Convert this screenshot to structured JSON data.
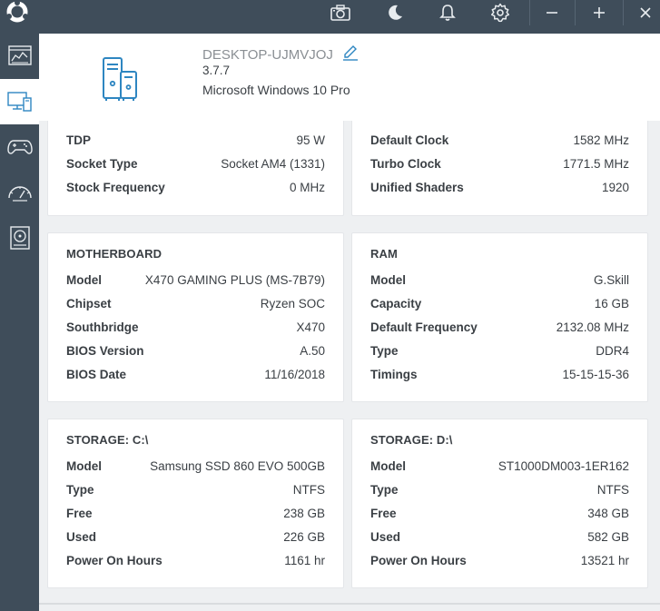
{
  "app": {
    "logo": "app-logo"
  },
  "titlebar": {
    "icons": [
      "camera-icon",
      "moon-icon",
      "bell-icon",
      "gear-icon",
      "minimize-icon",
      "add-icon",
      "close-icon"
    ]
  },
  "sidebar": {
    "items": [
      {
        "name": "dashboard-icon",
        "active": false
      },
      {
        "name": "system-info-icon",
        "active": true
      },
      {
        "name": "gamepad-icon",
        "active": false
      },
      {
        "name": "speedometer-icon",
        "active": false
      },
      {
        "name": "disk-icon",
        "active": false
      }
    ]
  },
  "header": {
    "hostname": "DESKTOP-UJMVJOJ",
    "version": "3.7.7",
    "os": "Microsoft Windows 10 Pro"
  },
  "cpu_partial": {
    "rows": [
      {
        "key": "TDP",
        "value": "95 W"
      },
      {
        "key": "Socket Type",
        "value": "Socket AM4 (1331)"
      },
      {
        "key": "Stock Frequency",
        "value": "0 MHz"
      }
    ]
  },
  "gpu_partial": {
    "rows": [
      {
        "key": "Default Clock",
        "value": "1582 MHz"
      },
      {
        "key": "Turbo Clock",
        "value": "1771.5 MHz"
      },
      {
        "key": "Unified Shaders",
        "value": "1920"
      }
    ]
  },
  "motherboard": {
    "title": "MOTHERBOARD",
    "rows": [
      {
        "key": "Model",
        "value": "X470 GAMING PLUS (MS-7B79)"
      },
      {
        "key": "Chipset",
        "value": "Ryzen SOC"
      },
      {
        "key": "Southbridge",
        "value": "X470"
      },
      {
        "key": "BIOS Version",
        "value": "A.50"
      },
      {
        "key": "BIOS Date",
        "value": "11/16/2018"
      }
    ]
  },
  "ram": {
    "title": "RAM",
    "rows": [
      {
        "key": "Model",
        "value": "G.Skill"
      },
      {
        "key": "Capacity",
        "value": "16 GB"
      },
      {
        "key": "Default Frequency",
        "value": "2132.08 MHz"
      },
      {
        "key": "Type",
        "value": "DDR4"
      },
      {
        "key": "Timings",
        "value": "15-15-15-36"
      }
    ]
  },
  "storage_c": {
    "title": "STORAGE: C:\\",
    "rows": [
      {
        "key": "Model",
        "value": "Samsung SSD 860 EVO 500GB"
      },
      {
        "key": "Type",
        "value": "NTFS"
      },
      {
        "key": "Free",
        "value": "238 GB"
      },
      {
        "key": "Used",
        "value": "226 GB"
      },
      {
        "key": "Power On Hours",
        "value": "1161 hr"
      }
    ]
  },
  "storage_d": {
    "title": "STORAGE: D:\\",
    "rows": [
      {
        "key": "Model",
        "value": "ST1000DM003-1ER162"
      },
      {
        "key": "Type",
        "value": "NTFS"
      },
      {
        "key": "Free",
        "value": "348 GB"
      },
      {
        "key": "Used",
        "value": "582 GB"
      },
      {
        "key": "Power On Hours",
        "value": "13521 hr"
      }
    ]
  },
  "colors": {
    "chrome": "#3f4d5a",
    "accent": "#2e86c1",
    "text": "#3a3f44",
    "muted": "#8a8f94"
  }
}
